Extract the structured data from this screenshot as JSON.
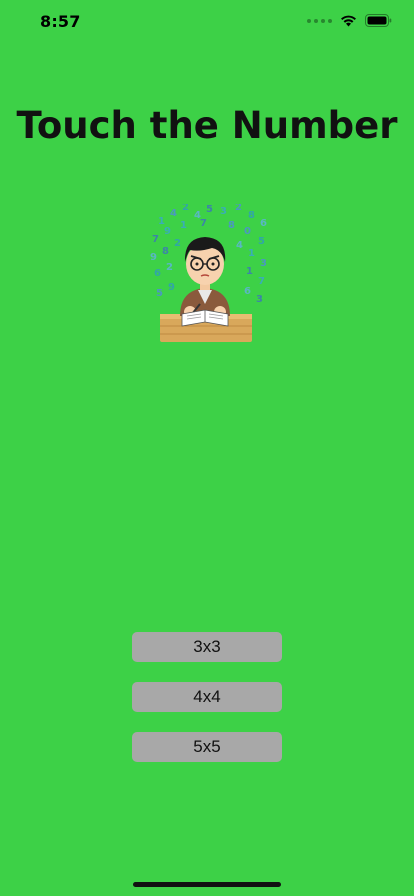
{
  "status_bar": {
    "time": "8:57",
    "icons": [
      "signal-icon",
      "wifi-icon",
      "battery-icon"
    ]
  },
  "title": "Touch the Number",
  "illustration": {
    "icon": "student-studying-numbers-illustration",
    "floating_digits": [
      "1",
      "4",
      "2",
      "4",
      "5",
      "3",
      "2",
      "8",
      "6",
      "7",
      "9",
      "0",
      "5",
      "9",
      "8",
      "1",
      "3",
      "6",
      "2",
      "1",
      "7",
      "5",
      "9",
      "6",
      "3",
      "1",
      "8",
      "2",
      "4",
      "7"
    ]
  },
  "buttons": [
    {
      "label": "3x3"
    },
    {
      "label": "4x4"
    },
    {
      "label": "5x5"
    }
  ],
  "colors": {
    "background": "#3dd147",
    "button": "#a8a8a8",
    "text": "#111111"
  }
}
